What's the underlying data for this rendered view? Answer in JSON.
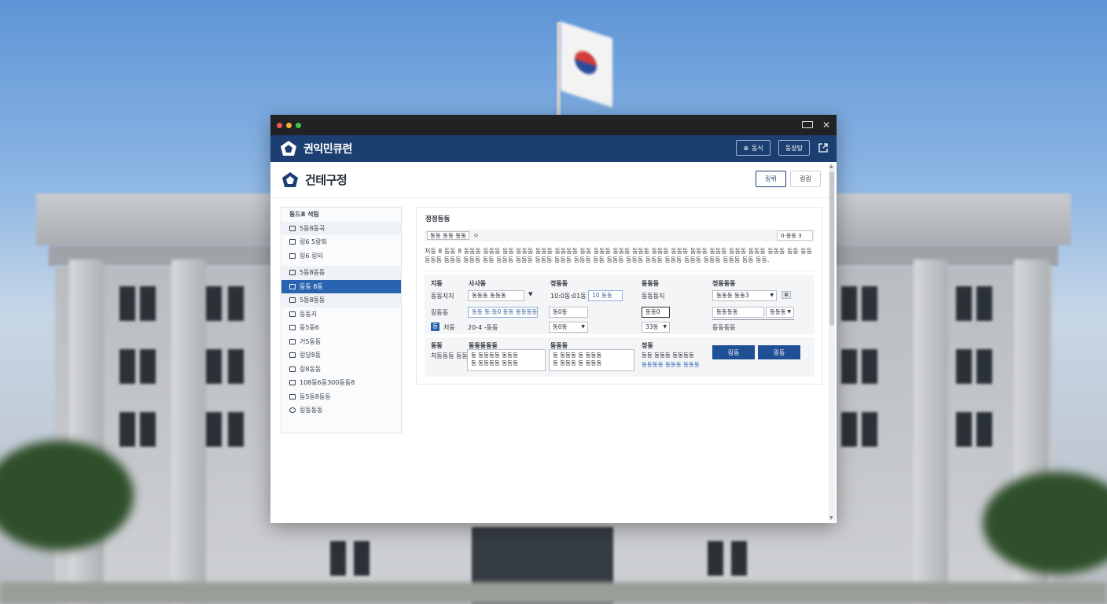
{
  "window": {
    "app_title": "권익민큐련",
    "header_buttons": [
      {
        "label": "동식",
        "icon": "globe-icon"
      },
      {
        "label": "동장탕"
      }
    ]
  },
  "page": {
    "title": "건테구정",
    "buttons": [
      "링뤼",
      "링링"
    ]
  },
  "sidebar": {
    "items": [
      {
        "label": "동드8 석림",
        "kind": "head"
      },
      {
        "label": "5동8동곡",
        "kind": "group"
      },
      {
        "label": "링6 5랑퇴",
        "kind": "item"
      },
      {
        "label": "링6 링되",
        "kind": "item"
      },
      {
        "label": "5동8동동",
        "kind": "group"
      },
      {
        "label": "동동 8동",
        "kind": "active"
      },
      {
        "label": "5동8동동",
        "kind": "sub"
      },
      {
        "label": "동동지",
        "kind": "item"
      },
      {
        "label": "동5동6",
        "kind": "item"
      },
      {
        "label": "거5동동",
        "kind": "item"
      },
      {
        "label": "링당8동",
        "kind": "item"
      },
      {
        "label": "링8동동",
        "kind": "item"
      },
      {
        "label": "108동6동300동동8",
        "kind": "item"
      },
      {
        "label": "동5동8동동",
        "kind": "item"
      },
      {
        "label": "링동동동",
        "kind": "item"
      }
    ]
  },
  "main": {
    "section_title": "정정등동",
    "filter_chip": "동동 동동 동동",
    "filter_tail": "ㅇ",
    "filter_select": "0-동동 3",
    "description": "처동 8 동동 8 동동동 동동동 동동 동동동 동동동 동동동동 동동 동동동 동동동 동동동 동동동 동동동 동동동 동동동 동동동 동동동 동동동 동동 동동 동동동 동동동 동동동 동동 동동동 동동동 동동동 동동동 동동동 동동 동동동 동동동 동동동 동동동 동동동 동동동 동동동 동동 동동.",
    "grid": {
      "headers": [
        "지동",
        "사사동",
        "정동동",
        "동동동",
        "정동동동"
      ],
      "row1": {
        "label": "동동지지",
        "col1": "동동동 동동동",
        "col2": "10:0동:01동",
        "col2_tag": "10 동동",
        "col3": "동동동지",
        "col4": "동동동 동동3"
      },
      "row2": {
        "label": "링동동",
        "col1": "동동 동:동0 동동 동동동동",
        "col2": "동0동",
        "col3": "동동0",
        "col4": "동동동동",
        "col4b": "동동동"
      },
      "row3": {
        "badge": "동",
        "label": "처동",
        "col1": "20-4 -동동",
        "col2": "동0동",
        "col3": "33동",
        "col4": "동동동동"
      }
    },
    "bottom": {
      "label1": "동동",
      "label2": "처동동동 동동",
      "col1_title": "동동동동동",
      "col1_text": [
        "동 동동동동 동동동",
        "동 동동동동 동동동"
      ],
      "col2_title": "동동동",
      "col2_text": [
        "동 동동동 동 동동동",
        "동 동동동 동 동동동"
      ],
      "col3_title": "정동",
      "col3_text": "동동 동동동 동동동동",
      "col3_link": "동동동동 동동동 동동동",
      "buttons": [
        "링동",
        "링동"
      ]
    }
  }
}
